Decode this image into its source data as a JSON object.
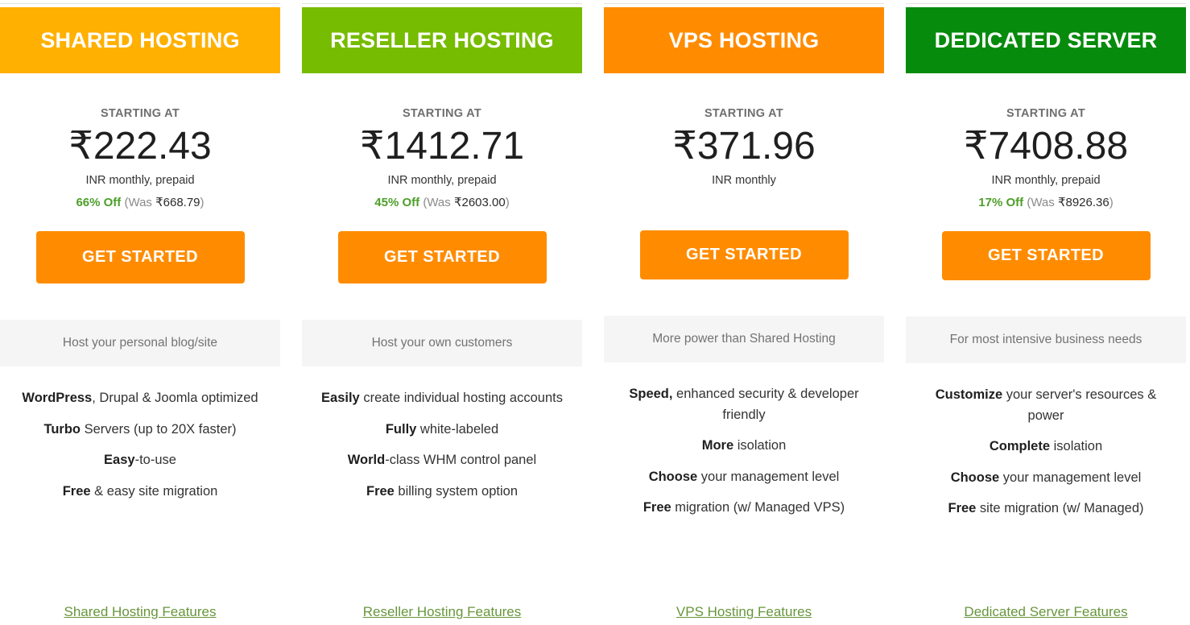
{
  "theme": {
    "cta_color": "#ff8c00",
    "discount_green": "#4d9e2a",
    "link_green": "#67963b",
    "band_gray": "#f5f5f5"
  },
  "plans": [
    {
      "title": "SHARED HOSTING",
      "header_color": "#ffb000",
      "starting_at": "STARTING AT",
      "price": "₹222.43",
      "terms": "INR monthly, prepaid",
      "discount_percent": "66% Off",
      "discount_was_prefix": " (Was ",
      "discount_was_amount": "₹668.79",
      "discount_suffix": ")",
      "cta_label": "GET STARTED",
      "tagline": "Host your personal blog/site",
      "features": [
        {
          "bold": "WordPress",
          "rest": ", Drupal & Joomla optimized"
        },
        {
          "bold": "Turbo",
          "rest": " Servers (up to 20X faster)"
        },
        {
          "bold": "Easy",
          "rest": "-to-use"
        },
        {
          "bold": "Free",
          "rest": " & easy site migration"
        }
      ],
      "features_link": "Shared Hosting Features"
    },
    {
      "title": "RESELLER HOSTING",
      "header_color": "#76bc00",
      "starting_at": "STARTING AT",
      "price": "₹1412.71",
      "terms": "INR monthly, prepaid",
      "discount_percent": "45% Off",
      "discount_was_prefix": " (Was ",
      "discount_was_amount": "₹2603.00",
      "discount_suffix": ")",
      "cta_label": "GET STARTED",
      "tagline": "Host your own customers",
      "features": [
        {
          "bold": "Easily",
          "rest": " create individual hosting accounts"
        },
        {
          "bold": "Fully",
          "rest": " white-labeled"
        },
        {
          "bold": "World",
          "rest": "-class WHM control panel"
        },
        {
          "bold": "Free",
          "rest": " billing system option"
        }
      ],
      "features_link": "Reseller Hosting Features"
    },
    {
      "title": "VPS HOSTING",
      "header_color": "#ff8c00",
      "starting_at": "STARTING AT",
      "price": "₹371.96",
      "terms": "INR monthly",
      "discount_percent": "",
      "discount_was_prefix": "",
      "discount_was_amount": "",
      "discount_suffix": "",
      "cta_label": "GET STARTED",
      "tagline": "More power than Shared Hosting",
      "features": [
        {
          "bold": "Speed,",
          "rest": " enhanced security & developer friendly"
        },
        {
          "bold": "More",
          "rest": " isolation"
        },
        {
          "bold": "Choose",
          "rest": " your management level"
        },
        {
          "bold": "Free",
          "rest": " migration (w/ Managed VPS)"
        }
      ],
      "features_link": "VPS Hosting Features"
    },
    {
      "title": "DEDICATED SERVER",
      "header_color": "#068b0d",
      "starting_at": "STARTING AT",
      "price": "₹7408.88",
      "terms": "INR monthly, prepaid",
      "discount_percent": "17% Off",
      "discount_was_prefix": " (Was ",
      "discount_was_amount": "₹8926.36",
      "discount_suffix": ")",
      "cta_label": "GET STARTED",
      "tagline": "For most intensive business needs",
      "features": [
        {
          "bold": "Customize",
          "rest": " your server's resources & power"
        },
        {
          "bold": "Complete",
          "rest": " isolation"
        },
        {
          "bold": "Choose",
          "rest": " your management level"
        },
        {
          "bold": "Free",
          "rest": " site migration (w/ Managed)"
        }
      ],
      "features_link": "Dedicated Server Features"
    }
  ]
}
